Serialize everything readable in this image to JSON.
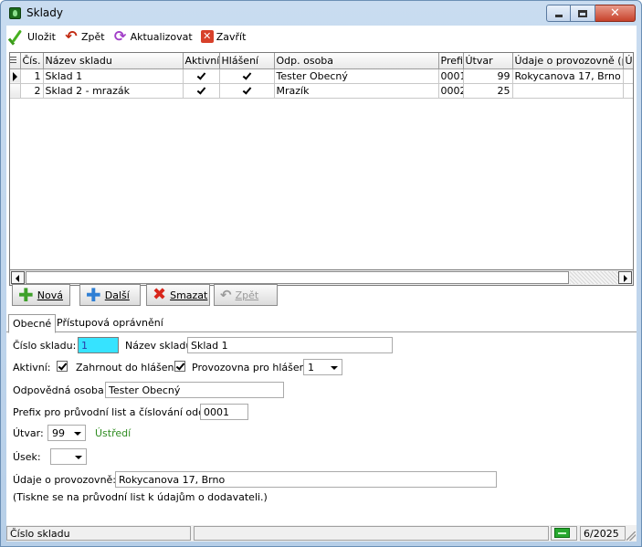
{
  "window": {
    "title": "Sklady"
  },
  "toolbar": {
    "save_label": "Uložit",
    "back_label": "Zpět",
    "refresh_label": "Aktualizovat",
    "close_label": "Zavřít"
  },
  "grid": {
    "columns": [
      "Čís.",
      "Název skladu",
      "Aktivní",
      "Hlášení",
      "Odp. osoba",
      "Prefi",
      "Útvar",
      "Údaje o provozovně (pr",
      "Ús"
    ],
    "rows": [
      {
        "cislo": "1",
        "nazev": "Sklad 1",
        "aktivni": true,
        "hlaseni": true,
        "osoba": "Tester Obecný",
        "prefix": "0001",
        "utvar": "99",
        "udaje": "Rokycanova 17, Brno",
        "usek": ""
      },
      {
        "cislo": "2",
        "nazev": "Sklad 2 - mrazák",
        "aktivni": true,
        "hlaseni": true,
        "osoba": "Mrazík",
        "prefix": "0002",
        "utvar": "25",
        "udaje": "",
        "usek": ""
      }
    ]
  },
  "actions": {
    "new_label": "Nová",
    "next_label": "Další",
    "delete_label": "Smazat",
    "undo_label": "Zpět"
  },
  "tabs": [
    "Obecné",
    "Přístupová oprávnění"
  ],
  "form": {
    "cislo_label": "Číslo skladu:",
    "cislo_value": "1",
    "nazev_label": "Název skladu:",
    "nazev_value": "Sklad 1",
    "aktivni_label": "Aktivní:",
    "hlaseni_label": "Zahrnout do hlášení:",
    "provozovna_label": "Provozovna pro hlášení:",
    "provozovna_value": "1",
    "osoba_label": "Odpovědná osoba:",
    "osoba_value": "Tester Obecný",
    "prefix_label": "Prefix pro průvodní list a číslování oddílů:",
    "prefix_value": "0001",
    "utvar_label": "Útvar:",
    "utvar_value": "99",
    "utvar_name": "Ústředí",
    "usek_label": "Úsek:",
    "usek_value": "",
    "udaje_label": "Údaje o provozovně:",
    "udaje_value": "Rokycanova 17, Brno",
    "note": "(Tiskne se na průvodní list k údajům o dodavateli.)"
  },
  "status": {
    "hint": "Číslo skladu",
    "period": "6/2025"
  },
  "colors": {
    "focus_bg": "#36e3ff",
    "green_text": "#2e8b1f",
    "close_btn": "#c7422b"
  },
  "icons": [
    "app-icon",
    "check-icon",
    "undo-icon",
    "refresh-icon",
    "close-icon",
    "plus-icon",
    "delete-icon"
  ]
}
